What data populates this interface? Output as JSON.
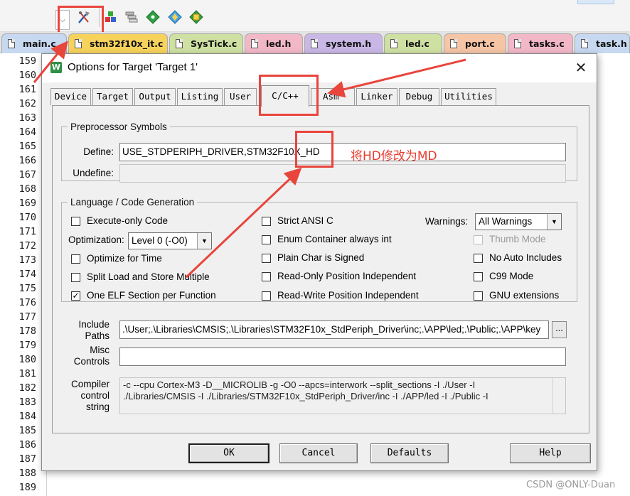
{
  "toolbar": {
    "combo_arrow": "⌵",
    "buttons": [
      {
        "name": "options-for-target-icon"
      },
      {
        "name": "manage-project-items-icon"
      },
      {
        "name": "select-packs-icon"
      },
      {
        "name": "manage-runtime-icon"
      },
      {
        "name": "pack-installer-icon"
      },
      {
        "name": "run-time-environment-icon"
      }
    ]
  },
  "file_tabs": [
    {
      "label": "main.c",
      "color": "#c7d9f1"
    },
    {
      "label": "stm32f10x_it.c",
      "color": "#f7d35c"
    },
    {
      "label": "SysTick.c",
      "color": "#cfe1a2"
    },
    {
      "label": "led.h",
      "color": "#f2b8c8"
    },
    {
      "label": "system.h",
      "color": "#c9b7e6"
    },
    {
      "label": "led.c",
      "color": "#cfe1a2"
    },
    {
      "label": "port.c",
      "color": "#f6c5a6"
    },
    {
      "label": "tasks.c",
      "color": "#f2b8c8"
    },
    {
      "label": "task.h",
      "color": "#c7d9f1"
    }
  ],
  "line_numbers": [
    "159",
    "160",
    "161",
    "162",
    "163",
    "164",
    "165",
    "166",
    "167",
    "168",
    "169",
    "170",
    "171",
    "172",
    "173",
    "174",
    "175",
    "176",
    "177",
    "178",
    "179",
    "180",
    "181",
    "182",
    "183",
    "184",
    "185",
    "186",
    "187",
    "188",
    "189"
  ],
  "dialog": {
    "title": "Options for Target 'Target 1'",
    "app_icon_letter": "W",
    "close": "✕",
    "tabs": [
      "Device",
      "Target",
      "Output",
      "Listing",
      "User",
      "C/C++",
      "Asm",
      "Linker",
      "Debug",
      "Utilities"
    ],
    "active_tab": "C/C++",
    "preprocessor": {
      "legend": "Preprocessor Symbols",
      "define_label": "Define:",
      "define_value": "USE_STDPERIPH_DRIVER,STM32F10X_HD",
      "undefine_label": "Undefine:",
      "undefine_value": ""
    },
    "language": {
      "legend": "Language / Code Generation",
      "execute_only": "Execute-only Code",
      "optimization_label": "Optimization:",
      "optimization_value": "Level 0 (-O0)",
      "optimize_time": "Optimize for Time",
      "split_load": "Split Load and Store Multiple",
      "one_elf": "One ELF Section per Function",
      "strict_ansi": "Strict ANSI C",
      "enum_container": "Enum Container always int",
      "plain_char": "Plain Char is Signed",
      "ro_pi": "Read-Only Position Independent",
      "rw_pi": "Read-Write Position Independent",
      "warnings_label": "Warnings:",
      "warnings_value": "All Warnings",
      "thumb_mode": "Thumb Mode",
      "no_auto_includes": "No Auto Includes",
      "c99_mode": "C99 Mode",
      "gnu_extensions": "GNU extensions",
      "check": "✓"
    },
    "include": {
      "label_1": "Include",
      "label_2": "Paths",
      "value": ".\\User;.\\Libraries\\CMSIS;.\\Libraries\\STM32F10x_StdPeriph_Driver\\inc;.\\APP\\led;.\\Public;.\\APP\\key",
      "browse": "..."
    },
    "misc": {
      "label_1": "Misc",
      "label_2": "Controls",
      "value": ""
    },
    "compiler": {
      "label_1": "Compiler",
      "label_2": "control",
      "label_3": "string",
      "line_1": "-c --cpu Cortex-M3 -D__MICROLIB -g -O0 --apcs=interwork --split_sections -I ./User -I",
      "line_2": "./Libraries/CMSIS -I ./Libraries/STM32F10x_StdPeriph_Driver/inc -I ./APP/led -I ./Public -I"
    },
    "buttons": {
      "ok": "OK",
      "cancel": "Cancel",
      "defaults": "Defaults",
      "help": "Help"
    }
  },
  "annotation": {
    "text": "将HD修改为MD",
    "color": "#e8453c"
  },
  "watermark": "CSDN @ONLY-Duan"
}
